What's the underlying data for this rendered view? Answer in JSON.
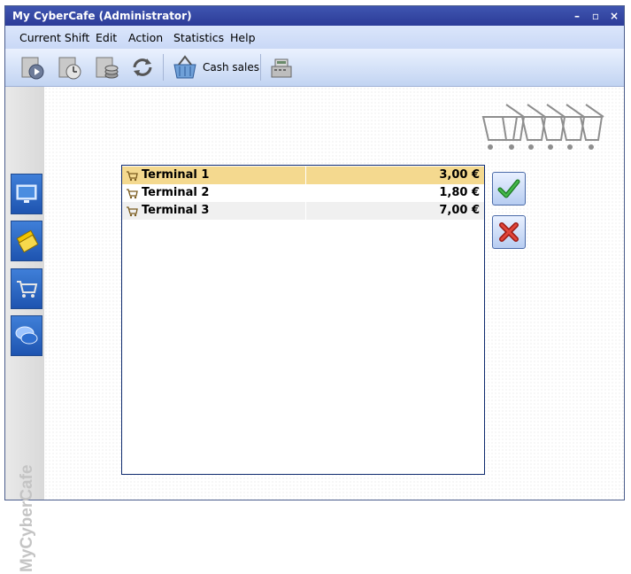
{
  "window": {
    "title": "My CyberCafe  (Administrator)"
  },
  "controls": {
    "minimize": "–",
    "maximize": "▫",
    "close": "×"
  },
  "menu": [
    "Current Shift",
    "Edit",
    "Action",
    "Statistics",
    "Help"
  ],
  "toolbar": {
    "buttons": [
      "start-shift-icon",
      "shift-clock-icon",
      "shift-money-icon",
      "refresh-icon",
      "cash-basket-icon",
      "cash-register-icon"
    ],
    "cash_sales_label": "Cash sales"
  },
  "sidebar": {
    "tabs": [
      "monitor-icon",
      "tickets-icon",
      "shopping-cart-icon",
      "chat-icon"
    ],
    "brand": "MyCyberCafe"
  },
  "terminals": [
    {
      "name": "Terminal 1",
      "amount": "3,00 €",
      "selected": true
    },
    {
      "name": "Terminal 2",
      "amount": "1,80 €",
      "selected": false
    },
    {
      "name": "Terminal 3",
      "amount": "7,00 €",
      "selected": false
    }
  ],
  "colors": {
    "selected_row": "#f4d98f",
    "alt_row": "#f0f0f0",
    "accent": "#2c3c98"
  }
}
